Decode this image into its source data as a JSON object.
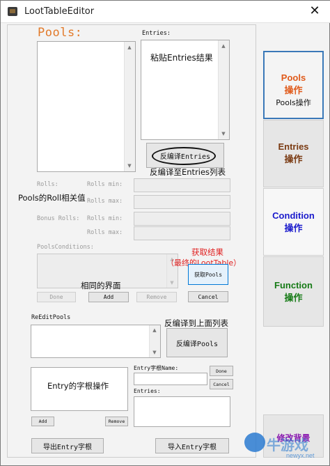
{
  "window": {
    "title": "LootTableEditor",
    "close_glyph": "✕"
  },
  "pools_heading": "Pools:",
  "entries_label": "Entries:",
  "annotations": {
    "paste_entries_result": "粘贴Entries结果",
    "decompile_to_entries_list": "反编译至Entries列表",
    "pools_roll_related": "Pools的Roll相关值",
    "same_ui": "相同的界面",
    "get_result": "获取结果",
    "final_loottable": "（最终的LootTable）",
    "decompile_to_list_above": "反编译到上面列表",
    "entry_root_ops": "Entry的字根操作",
    "watermark": "牛游戏",
    "watermark_url": "newyx.net"
  },
  "decompile_entries_button": "反编译Entries",
  "rolls": {
    "rolls_label": "Rolls:",
    "rolls_min": "Rolls min:",
    "rolls_max": "Rolls max:",
    "bonus_rolls": "Bonus Rolls:",
    "bonus_rolls_min": "Rolls min:",
    "bonus_rolls_max": "Rolls max:"
  },
  "pools_conditions_label": "PoolsConditions:",
  "get_pools_button": "获取Pools",
  "pool_buttons": {
    "done": "Done",
    "add": "Add",
    "remove": "Remove",
    "cancel": "Cancel"
  },
  "reedit": {
    "label": "ReEditPools",
    "decompile_pools_button": "反编译Pools"
  },
  "entry_root": {
    "name_label": "Entry字根Name:",
    "done": "Done",
    "cancel": "Cancel",
    "entries_label": "Entries:",
    "add": "Add",
    "remove": "Remove"
  },
  "export_button": "导出Entry字根",
  "import_button": "导入Entry字根",
  "side_tabs": [
    {
      "line1": "Pools",
      "line2": "操作",
      "line3": "Pools操作",
      "color": "#e05a1a"
    },
    {
      "line1": "Entries",
      "line2": "操作",
      "color": "#7a3a12"
    },
    {
      "line1": "Condition",
      "line2": "操作",
      "color": "#1a1acc"
    },
    {
      "line1": "Function",
      "line2": "操作",
      "color": "#157a15"
    },
    {
      "line1": "修改背景",
      "color": "#8a1ab0"
    }
  ]
}
